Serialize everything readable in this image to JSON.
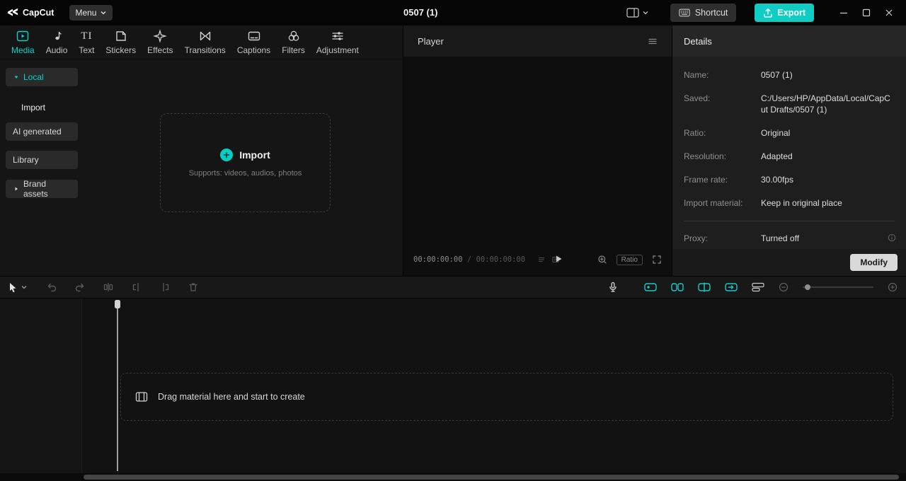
{
  "app": {
    "name": "CapCut"
  },
  "colors": {
    "accent": "#00d5ce",
    "export_button": "#10cdc3"
  },
  "titlebar": {
    "menu": "Menu",
    "project_title": "0507 (1)",
    "shortcut": "Shortcut",
    "export": "Export"
  },
  "tabs": [
    {
      "label": "Media"
    },
    {
      "label": "Audio"
    },
    {
      "label": "Text",
      "icon_text": "TI"
    },
    {
      "label": "Stickers"
    },
    {
      "label": "Effects"
    },
    {
      "label": "Transitions"
    },
    {
      "label": "Captions"
    },
    {
      "label": "Filters"
    },
    {
      "label": "Adjustment"
    }
  ],
  "sidebar": {
    "local": "Local",
    "import": "Import",
    "ai_generated": "AI generated",
    "library": "Library",
    "brand_assets": "Brand assets"
  },
  "dropzone": {
    "title": "Import",
    "subtitle": "Supports: videos, audios, photos"
  },
  "player": {
    "title": "Player",
    "time_current": "00:00:00:00",
    "time_separator": "/",
    "time_total": "00:00:00:00",
    "ratio": "Ratio"
  },
  "details": {
    "title": "Details",
    "rows": [
      {
        "label": "Name:",
        "value": "0507 (1)"
      },
      {
        "label": "Saved:",
        "value": "C:/Users/HP/AppData/Local/CapCut Drafts/0507 (1)"
      },
      {
        "label": "Ratio:",
        "value": "Original"
      },
      {
        "label": "Resolution:",
        "value": "Adapted"
      },
      {
        "label": "Frame rate:",
        "value": "30.00fps"
      },
      {
        "label": "Import material:",
        "value": "Keep in original place"
      }
    ],
    "proxy": {
      "label": "Proxy:",
      "value": "Turned off"
    },
    "modify": "Modify"
  },
  "timeline": {
    "hint": "Drag material here and start to create"
  }
}
